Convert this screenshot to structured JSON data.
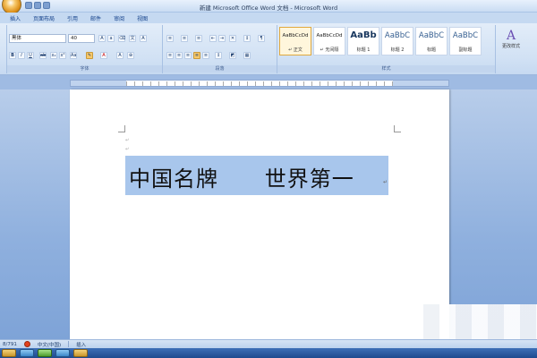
{
  "window": {
    "title": "新建 Microsoft Office Word 文档 - Microsoft Word"
  },
  "tabs": [
    "插入",
    "页面布局",
    "引用",
    "邮件",
    "审阅",
    "视图"
  ],
  "ribbon": {
    "font_name": "黑体",
    "font_size": "40",
    "groups": {
      "font": "字体",
      "paragraph": "段落",
      "styles": "样式"
    },
    "styles": [
      {
        "sample": "AaBbCcDd",
        "name": "↵ 正文"
      },
      {
        "sample": "AaBbCcDd",
        "name": "↵ 无间隔"
      },
      {
        "sample": "AaBb",
        "name": "标题 1"
      },
      {
        "sample": "AaBbC",
        "name": "标题 2"
      },
      {
        "sample": "AaBbC",
        "name": "标题"
      },
      {
        "sample": "AaBbC",
        "name": "副标题"
      }
    ],
    "change_styles_label": "更改样式"
  },
  "document": {
    "text": "中国名牌      世界第一"
  },
  "statusbar": {
    "page": "8/791",
    "language": "中文(中国)",
    "mode": "插入"
  },
  "colors": {
    "selection": "#a8c6ec",
    "ribbon": "#d1e1f4",
    "docarea": "#8fb0de"
  }
}
